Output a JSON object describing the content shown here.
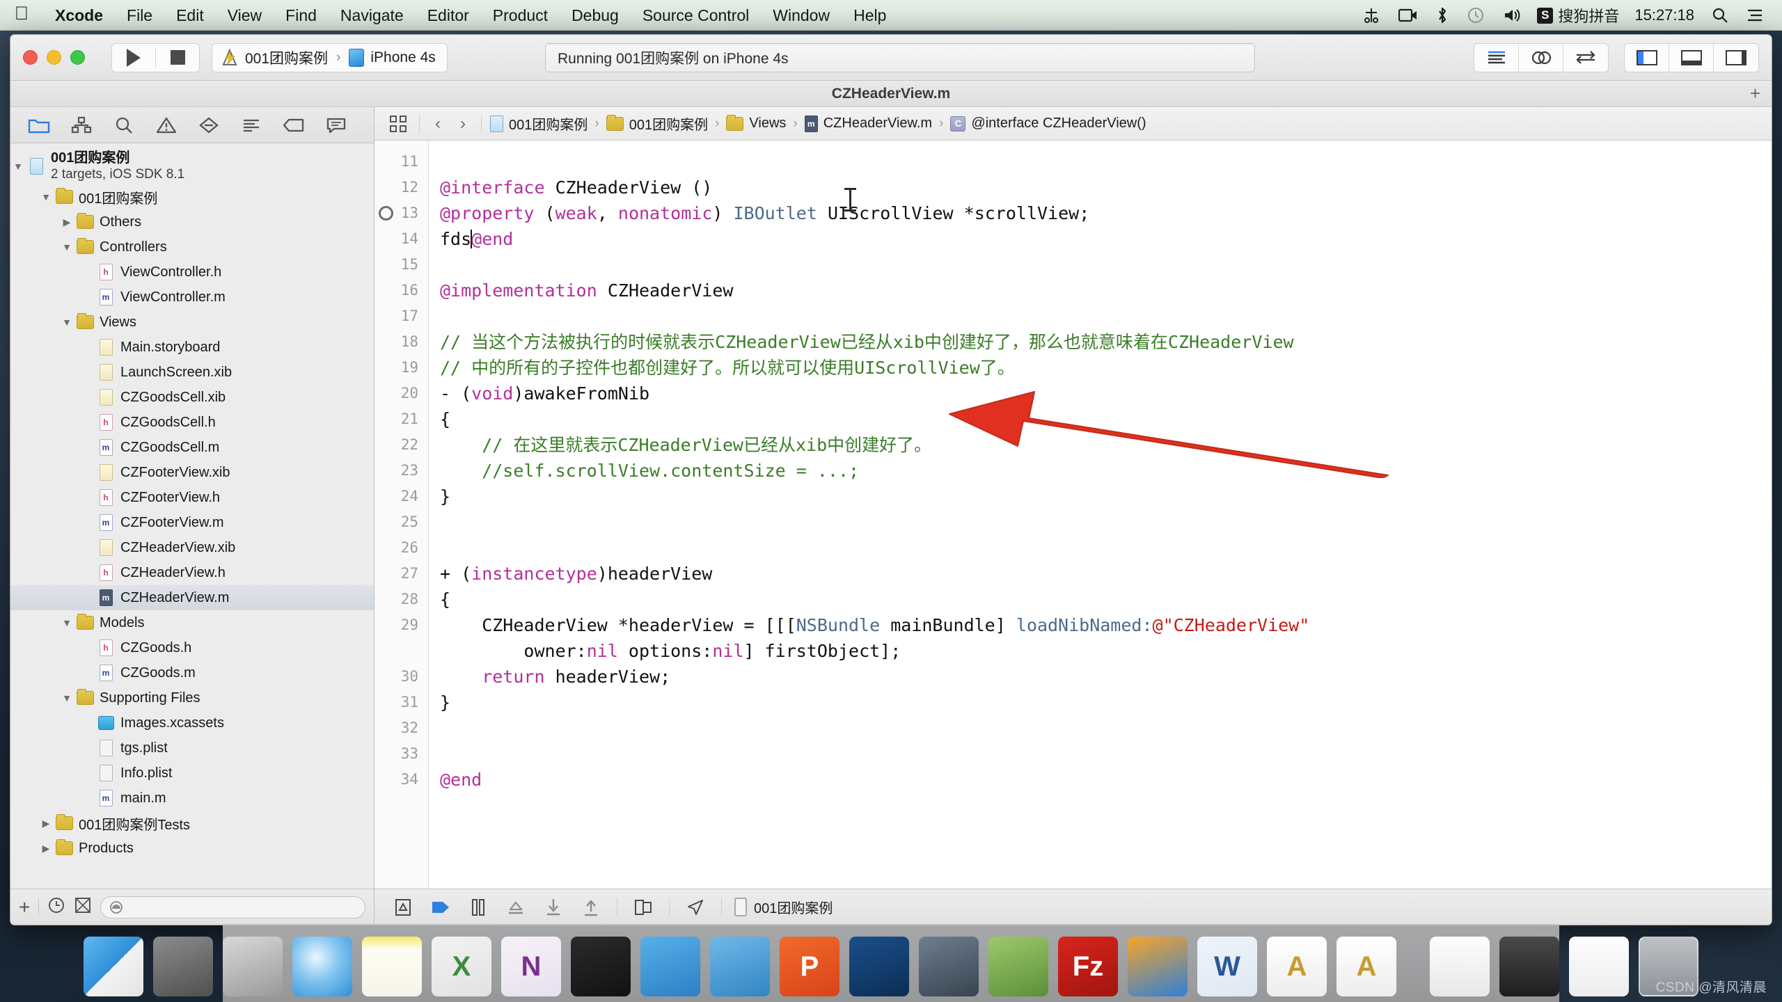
{
  "menubar": {
    "apple_icon": "apple-logo-icon",
    "items": [
      {
        "label": "Xcode",
        "bold": true
      },
      {
        "label": "File",
        "bold": false
      },
      {
        "label": "Edit",
        "bold": false
      },
      {
        "label": "View",
        "bold": false
      },
      {
        "label": "Find",
        "bold": false
      },
      {
        "label": "Navigate",
        "bold": false
      },
      {
        "label": "Editor",
        "bold": false
      },
      {
        "label": "Product",
        "bold": false
      },
      {
        "label": "Debug",
        "bold": false
      },
      {
        "label": "Source Control",
        "bold": false
      },
      {
        "label": "Window",
        "bold": false
      },
      {
        "label": "Help",
        "bold": false
      }
    ],
    "tray": {
      "airdrop_icon": "airdrop-scissors-icon",
      "screenrecord_icon": "screen-record-icon",
      "bluetooth_icon": "bluetooth-icon",
      "timemachine_icon": "time-machine-icon",
      "volume_icon": "volume-icon",
      "ime_badge": "S",
      "ime_label": "搜狗拼音",
      "clock": "15:27:18",
      "spotlight_icon": "search-icon",
      "notification_icon": "notification-center-icon"
    }
  },
  "toolbar": {
    "run_icon": "run-play-icon",
    "stop_icon": "stop-square-icon",
    "scheme_project": "001团购案例",
    "scheme_chevron": "›",
    "scheme_device": "iPhone 4s",
    "status_text": "Running 001团购案例 on iPhone 4s",
    "editor_standard_icon": "standard-editor-icon",
    "editor_assistant_icon": "assistant-editor-icon",
    "editor_version_icon": "version-editor-icon",
    "view_navigator_icon": "toggle-navigator-icon",
    "view_debug_icon": "toggle-debug-area-icon",
    "view_utilities_icon": "toggle-utilities-icon"
  },
  "window": {
    "title": "CZHeaderView.m",
    "add_tab_label": "+"
  },
  "navigator": {
    "tabs": [
      {
        "name": "project-navigator",
        "icon": "folder-icon",
        "active": true
      },
      {
        "name": "symbol-navigator",
        "icon": "hierarchy-icon",
        "active": false
      },
      {
        "name": "find-navigator",
        "icon": "search-icon",
        "active": false
      },
      {
        "name": "issue-navigator",
        "icon": "warning-triangle-icon",
        "active": false
      },
      {
        "name": "test-navigator",
        "icon": "diamond-minus-icon",
        "active": false
      },
      {
        "name": "debug-navigator",
        "icon": "debug-list-icon",
        "active": false
      },
      {
        "name": "breakpoint-navigator",
        "icon": "tag-icon",
        "active": false
      },
      {
        "name": "report-navigator",
        "icon": "speech-bubble-icon",
        "active": false
      }
    ],
    "project": {
      "name": "001团购案例",
      "subtitle": "2 targets, iOS SDK 8.1"
    },
    "tree": [
      {
        "label": "001团购案例",
        "indent": 1,
        "kind": "folder",
        "twisty": "down"
      },
      {
        "label": "Others",
        "indent": 2,
        "kind": "folder",
        "twisty": "right"
      },
      {
        "label": "Controllers",
        "indent": 2,
        "kind": "folder",
        "twisty": "down"
      },
      {
        "label": "ViewController.h",
        "indent": 3,
        "kind": "h",
        "twisty": ""
      },
      {
        "label": "ViewController.m",
        "indent": 3,
        "kind": "m",
        "twisty": ""
      },
      {
        "label": "Views",
        "indent": 2,
        "kind": "folder",
        "twisty": "down"
      },
      {
        "label": "Main.storyboard",
        "indent": 3,
        "kind": "sb",
        "twisty": ""
      },
      {
        "label": "LaunchScreen.xib",
        "indent": 3,
        "kind": "xib",
        "twisty": ""
      },
      {
        "label": "CZGoodsCell.xib",
        "indent": 3,
        "kind": "xib",
        "twisty": ""
      },
      {
        "label": "CZGoodsCell.h",
        "indent": 3,
        "kind": "h",
        "twisty": ""
      },
      {
        "label": "CZGoodsCell.m",
        "indent": 3,
        "kind": "m",
        "twisty": ""
      },
      {
        "label": "CZFooterView.xib",
        "indent": 3,
        "kind": "xib",
        "twisty": ""
      },
      {
        "label": "CZFooterView.h",
        "indent": 3,
        "kind": "h",
        "twisty": ""
      },
      {
        "label": "CZFooterView.m",
        "indent": 3,
        "kind": "m",
        "twisty": ""
      },
      {
        "label": "CZHeaderView.xib",
        "indent": 3,
        "kind": "xib",
        "twisty": ""
      },
      {
        "label": "CZHeaderView.h",
        "indent": 3,
        "kind": "h",
        "twisty": ""
      },
      {
        "label": "CZHeaderView.m",
        "indent": 3,
        "kind": "selm",
        "twisty": "",
        "selected": true
      },
      {
        "label": "Models",
        "indent": 2,
        "kind": "folder",
        "twisty": "down"
      },
      {
        "label": "CZGoods.h",
        "indent": 3,
        "kind": "h",
        "twisty": ""
      },
      {
        "label": "CZGoods.m",
        "indent": 3,
        "kind": "m",
        "twisty": ""
      },
      {
        "label": "Supporting Files",
        "indent": 2,
        "kind": "folder",
        "twisty": "down"
      },
      {
        "label": "Images.xcassets",
        "indent": 3,
        "kind": "xcassets",
        "twisty": ""
      },
      {
        "label": "tgs.plist",
        "indent": 3,
        "kind": "plist",
        "twisty": ""
      },
      {
        "label": "Info.plist",
        "indent": 3,
        "kind": "plist",
        "twisty": ""
      },
      {
        "label": "main.m",
        "indent": 3,
        "kind": "m",
        "twisty": ""
      },
      {
        "label": "001团购案例Tests",
        "indent": 1,
        "kind": "folder",
        "twisty": "right"
      },
      {
        "label": "Products",
        "indent": 1,
        "kind": "folder",
        "twisty": "right"
      }
    ],
    "footer": {
      "add_label": "+",
      "recent_icon": "clock-filter-icon",
      "sourcecontrol_icon": "source-control-filter-icon",
      "filter_icon": "filter-circle-icon",
      "filter_placeholder": ""
    }
  },
  "jumpbar": {
    "related_icon": "related-items-icon",
    "back_label": "‹",
    "forward_label": "›",
    "crumbs": [
      {
        "label": "001团购案例",
        "icon": "project-file-icon"
      },
      {
        "label": "001团购案例",
        "icon": "folder-icon"
      },
      {
        "label": "Views",
        "icon": "folder-icon"
      },
      {
        "label": "CZHeaderView.m",
        "icon": "m-file-icon"
      },
      {
        "label": "@interface CZHeaderView()",
        "icon": "interface-symbol-icon"
      }
    ]
  },
  "code": {
    "first_line_number": 11,
    "breakpoint_line": 13,
    "lines": [
      {
        "n": 11,
        "tokens": []
      },
      {
        "n": 12,
        "tokens": [
          {
            "t": "@interface",
            "c": "kw"
          },
          {
            "t": " ",
            "c": "pln"
          },
          {
            "t": "CZHeaderView",
            "c": "pln"
          },
          {
            "t": " ()",
            "c": "pln"
          }
        ]
      },
      {
        "n": 13,
        "tokens": [
          {
            "t": "@property",
            "c": "kw"
          },
          {
            "t": " (",
            "c": "pln"
          },
          {
            "t": "weak",
            "c": "kw"
          },
          {
            "t": ", ",
            "c": "pln"
          },
          {
            "t": "nonatomic",
            "c": "kw"
          },
          {
            "t": ") ",
            "c": "pln"
          },
          {
            "t": "IBOutlet",
            "c": "cls"
          },
          {
            "t": " ",
            "c": "pln"
          },
          {
            "t": "UIScrollView",
            "c": "pln"
          },
          {
            "t": " *scrollView;",
            "c": "pln"
          }
        ]
      },
      {
        "n": 14,
        "tokens": [
          {
            "t": "fds",
            "c": "pln"
          },
          {
            "t": "|CARET|",
            "c": "caret"
          },
          {
            "t": "@end",
            "c": "kw"
          }
        ]
      },
      {
        "n": 15,
        "tokens": []
      },
      {
        "n": 16,
        "tokens": [
          {
            "t": "@implementation",
            "c": "kw"
          },
          {
            "t": " ",
            "c": "pln"
          },
          {
            "t": "CZHeaderView",
            "c": "pln"
          }
        ]
      },
      {
        "n": 17,
        "tokens": []
      },
      {
        "n": 18,
        "tokens": [
          {
            "t": "// 当这个方法被执行的时候就表示CZHeaderView已经从xib中创建好了，那么也就意味着在CZHeaderView",
            "c": "cmt"
          }
        ]
      },
      {
        "n": 19,
        "tokens": [
          {
            "t": "// 中的所有的子控件也都创建好了。所以就可以使用UIScrollView了。",
            "c": "cmt"
          }
        ]
      },
      {
        "n": 20,
        "tokens": [
          {
            "t": "- (",
            "c": "pln"
          },
          {
            "t": "void",
            "c": "kw"
          },
          {
            "t": ")awakeFromNib",
            "c": "pln"
          }
        ]
      },
      {
        "n": 21,
        "tokens": [
          {
            "t": "{",
            "c": "pln"
          }
        ]
      },
      {
        "n": 22,
        "tokens": [
          {
            "t": "    // 在这里就表示CZHeaderView已经从xib中创建好了。",
            "c": "cmt"
          }
        ]
      },
      {
        "n": 23,
        "tokens": [
          {
            "t": "    //self.scrollView.contentSize = ...;",
            "c": "cmt"
          }
        ]
      },
      {
        "n": 24,
        "tokens": [
          {
            "t": "}",
            "c": "pln"
          }
        ]
      },
      {
        "n": 25,
        "tokens": []
      },
      {
        "n": 26,
        "tokens": []
      },
      {
        "n": 27,
        "tokens": [
          {
            "t": "+ (",
            "c": "pln"
          },
          {
            "t": "instancetype",
            "c": "kw"
          },
          {
            "t": ")headerView",
            "c": "pln"
          }
        ]
      },
      {
        "n": 28,
        "tokens": [
          {
            "t": "{",
            "c": "pln"
          }
        ]
      },
      {
        "n": 29,
        "tokens": [
          {
            "t": "    CZHeaderView *headerView = [[[",
            "c": "pln"
          },
          {
            "t": "NSBundle",
            "c": "cls"
          },
          {
            "t": " mainBundle] ",
            "c": "pln"
          },
          {
            "t": "loadNibNamed:",
            "c": "cls"
          },
          {
            "t": "@\"CZHeaderView\"",
            "c": "str"
          }
        ]
      },
      {
        "n": 29,
        "cont": true,
        "tokens": [
          {
            "t": "        owner:",
            "c": "pln"
          },
          {
            "t": "nil",
            "c": "kw"
          },
          {
            "t": " options:",
            "c": "pln"
          },
          {
            "t": "nil",
            "c": "kw"
          },
          {
            "t": "] firstObject];",
            "c": "pln"
          }
        ]
      },
      {
        "n": 30,
        "tokens": [
          {
            "t": "    ",
            "c": "pln"
          },
          {
            "t": "return",
            "c": "kw"
          },
          {
            "t": " headerView;",
            "c": "pln"
          }
        ]
      },
      {
        "n": 31,
        "tokens": [
          {
            "t": "}",
            "c": "pln"
          }
        ]
      },
      {
        "n": 32,
        "tokens": []
      },
      {
        "n": 33,
        "tokens": []
      },
      {
        "n": 34,
        "tokens": [
          {
            "t": "@end",
            "c": "kw"
          }
        ]
      }
    ]
  },
  "debugbar": {
    "hide_icon": "hide-debug-area-icon",
    "continue_icon": "continue-program-icon",
    "pause_icon": "pause-icon",
    "stepover_icon": "step-over-icon",
    "stepinto_icon": "step-into-icon",
    "stepout_icon": "step-out-icon",
    "viewhierarchy_icon": "view-hierarchy-icon",
    "location_icon": "simulate-location-icon",
    "process_icon": "device-icon",
    "process_label": "001团购案例"
  },
  "dock": {
    "apps": [
      {
        "name": "finder",
        "label": "",
        "running": true
      },
      {
        "name": "system-preferences",
        "label": "",
        "running": false
      },
      {
        "name": "launchpad",
        "label": "",
        "running": false
      },
      {
        "name": "safari",
        "label": "",
        "running": false
      },
      {
        "name": "stickies",
        "label": "",
        "running": false
      },
      {
        "name": "excel",
        "label": "X",
        "running": false
      },
      {
        "name": "onenote",
        "label": "N",
        "running": false
      },
      {
        "name": "terminal",
        "label": "",
        "running": false
      },
      {
        "name": "xcode",
        "label": "",
        "running": true
      },
      {
        "name": "simulator",
        "label": "",
        "running": true
      },
      {
        "name": "parallels",
        "label": "P",
        "running": true
      },
      {
        "name": "snipaste",
        "label": "",
        "running": false
      },
      {
        "name": "quicktime",
        "label": "",
        "running": true
      },
      {
        "name": "photos",
        "label": "",
        "running": false
      },
      {
        "name": "filezilla",
        "label": "Fz",
        "running": false
      },
      {
        "name": "firefox",
        "label": "",
        "running": true
      },
      {
        "name": "word",
        "label": "W",
        "running": false
      },
      {
        "name": "notes-a",
        "label": "A",
        "running": true
      },
      {
        "name": "notes-b",
        "label": "A",
        "running": true
      }
    ],
    "stacks": [
      {
        "name": "documents-stack"
      },
      {
        "name": "downloads-stack"
      },
      {
        "name": "pictures-stack"
      },
      {
        "name": "trash"
      }
    ]
  },
  "watermark": "CSDN @清风清晨"
}
